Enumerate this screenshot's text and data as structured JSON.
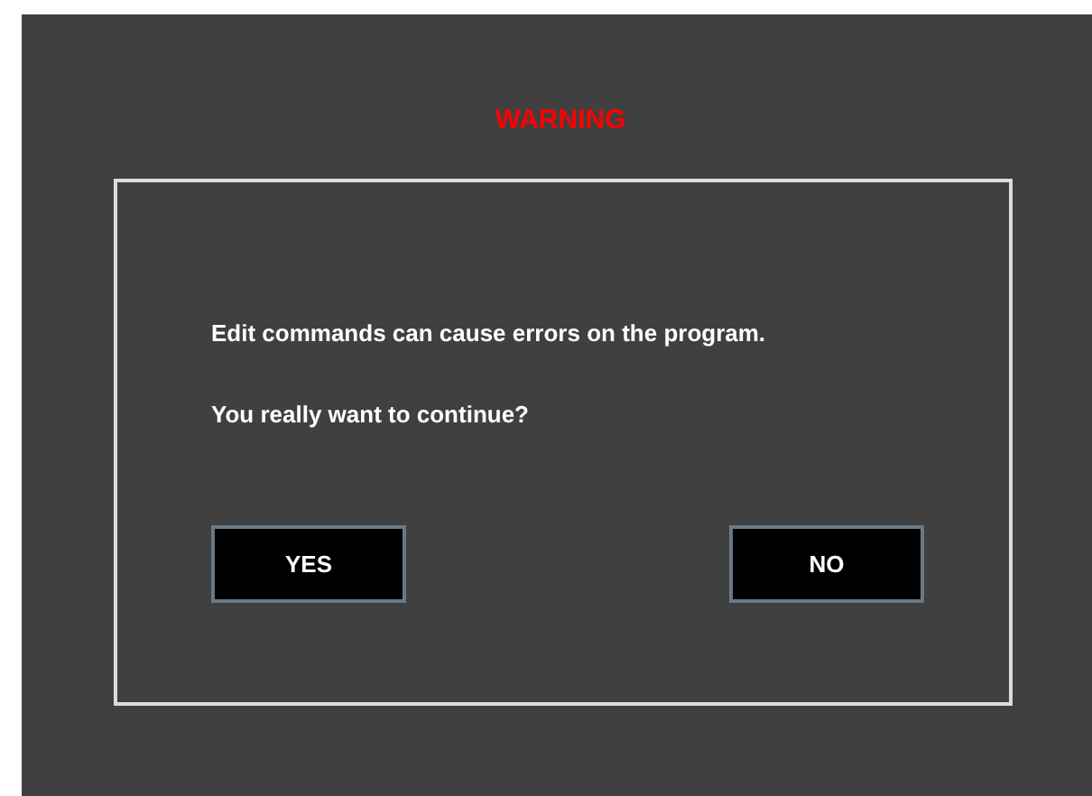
{
  "title": "WARNING",
  "messages": [
    "Edit commands can cause errors on the program.",
    "You really want to continue?"
  ],
  "buttons": [
    "YES",
    "NO"
  ]
}
